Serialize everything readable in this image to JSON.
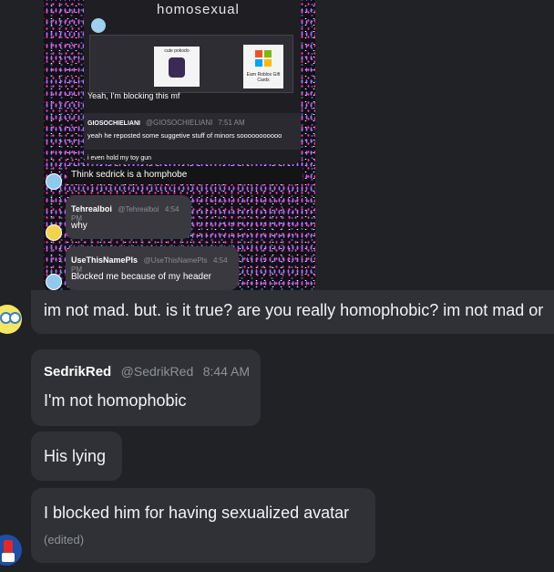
{
  "embed": {
    "overlay_title": "homosexual",
    "blocking_line": "Yeah, I'm blocking this mf",
    "inner_card_label": "cute pokodo",
    "inner_right_label": "Earn Roblox Gift Cards",
    "quote_name": "GIOSOCHIELIANI",
    "quote_handle": "@GIOSOCHIELIANI",
    "quote_time": "7:51 AM",
    "quote_text": "yeah he reposted some suggetive stuff of minors sooooooooooo",
    "quote_text2": "i even hold my toy gun",
    "caption": "Think sedrick is a homphobe",
    "messages": [
      {
        "name": "Tehrealboi",
        "handle": "@Tehrealboi",
        "time": "4:54 PM",
        "text": "why"
      },
      {
        "name": "UseThisNamePls",
        "handle": "@UseThisNamePls",
        "time": "4:54 PM",
        "text": "Blocked me because of my header"
      }
    ]
  },
  "question": {
    "text": "im not mad. but. is it true? are you really homophobic? im not mad or"
  },
  "reply": {
    "name": "SedrikRed",
    "handle": "@SedrikRed",
    "time": "8:44 AM",
    "messages": [
      {
        "text": "I'm not homophobic"
      },
      {
        "text": "His lying"
      },
      {
        "text": "I blocked him for having sexualized avatar",
        "edited": "(edited)"
      }
    ]
  },
  "colors": {
    "background": "#202225",
    "bubble": "#2f3136",
    "name": "#ffffff",
    "meta": "#8e9297"
  }
}
